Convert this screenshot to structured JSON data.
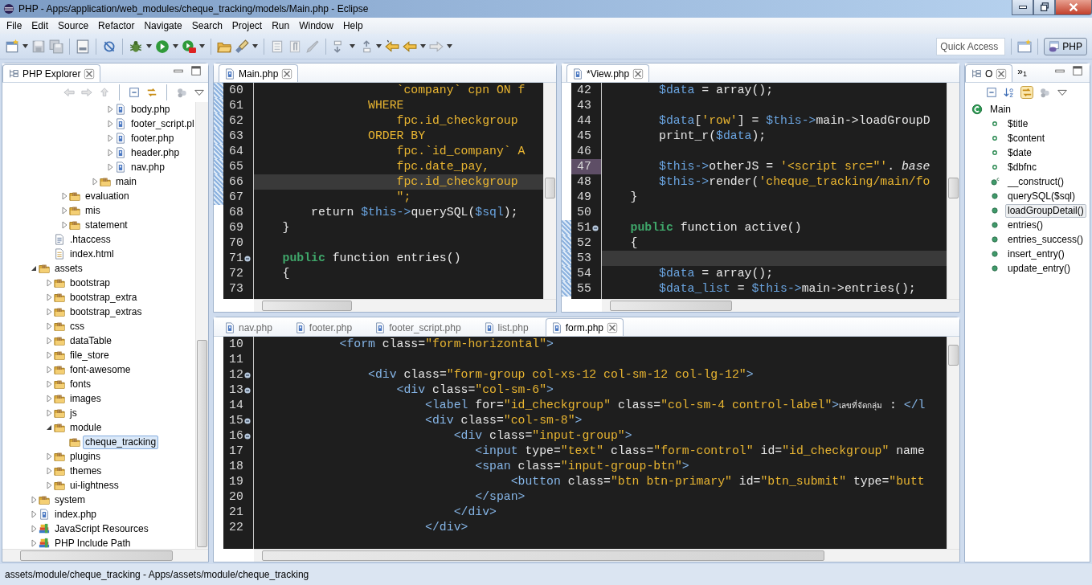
{
  "window": {
    "title": "PHP - Apps/application/web_modules/cheque_tracking/models/Main.php - Eclipse"
  },
  "menu": [
    "File",
    "Edit",
    "Source",
    "Refactor",
    "Navigate",
    "Search",
    "Project",
    "Run",
    "Window",
    "Help"
  ],
  "toolbar": {
    "quick_access": {
      "placeholder": "Quick Access"
    },
    "perspective": {
      "label": "PHP",
      "selected": true
    }
  },
  "explorer": {
    "title": "PHP Explorer",
    "tree": [
      {
        "children": [
          {
            "children": [
              {
                "children": [
                  {
                    "children": [
                      {
                        "children": [
                          {
                            "children": [
                              {
                                "label": "body.php",
                                "kind": "php",
                                "expanded": false,
                                "selected": false
                              },
                              {
                                "label": "footer_script.pl",
                                "kind": "php",
                                "expanded": false,
                                "selected": false
                              },
                              {
                                "label": "footer.php",
                                "kind": "php",
                                "expanded": false,
                                "selected": false
                              },
                              {
                                "label": "header.php",
                                "kind": "php",
                                "expanded": false,
                                "selected": false
                              },
                              {
                                "label": "nav.php",
                                "kind": "php",
                                "expanded": false,
                                "selected": false
                              }
                            ]
                          },
                          {
                            "label": "main",
                            "kind": "folder",
                            "expanded": false,
                            "selected": false
                          }
                        ]
                      }
                    ]
                  },
                  {
                    "label": "evaluation",
                    "kind": "folder",
                    "expanded": false,
                    "selected": false
                  },
                  {
                    "label": "mis",
                    "kind": "folder",
                    "expanded": false,
                    "selected": false
                  },
                  {
                    "label": "statement",
                    "kind": "folder",
                    "expanded": false,
                    "selected": false
                  }
                ]
              },
              {
                "label": ".htaccess",
                "kind": "text",
                "selected": false
              },
              {
                "label": "index.html",
                "kind": "html",
                "selected": false
              }
            ]
          },
          {
            "label": "assets",
            "kind": "folder",
            "expanded": true,
            "selected": false,
            "children": [
              {
                "label": "bootstrap",
                "kind": "folder",
                "expanded": false,
                "selected": false
              },
              {
                "label": "bootstrap_extra",
                "kind": "folder",
                "expanded": false,
                "selected": false
              },
              {
                "label": "bootstrap_extras",
                "kind": "folder",
                "expanded": false,
                "selected": false
              },
              {
                "label": "css",
                "kind": "folder",
                "expanded": false,
                "selected": false
              },
              {
                "label": "dataTable",
                "kind": "folder",
                "expanded": false,
                "selected": false
              },
              {
                "label": "file_store",
                "kind": "folder",
                "expanded": false,
                "selected": false
              },
              {
                "label": "font-awesome",
                "kind": "folder",
                "expanded": false,
                "selected": false
              },
              {
                "label": "fonts",
                "kind": "folder",
                "expanded": false,
                "selected": false
              },
              {
                "label": "images",
                "kind": "folder",
                "expanded": false,
                "selected": false
              },
              {
                "label": "js",
                "kind": "folder",
                "expanded": false,
                "selected": false
              },
              {
                "label": "module",
                "kind": "folder",
                "expanded": true,
                "selected": false,
                "children": [
                  {
                    "label": "cheque_tracking",
                    "kind": "folder",
                    "selected": true
                  }
                ]
              },
              {
                "label": "plugins",
                "kind": "folder",
                "expanded": false,
                "selected": false
              },
              {
                "label": "themes",
                "kind": "folder",
                "expanded": false,
                "selected": false
              },
              {
                "label": "ui-lightness",
                "kind": "folder",
                "expanded": false,
                "selected": false
              }
            ]
          },
          {
            "label": "system",
            "kind": "folder",
            "expanded": false,
            "selected": false
          },
          {
            "label": "index.php",
            "kind": "php",
            "expanded": false,
            "selected": false
          },
          {
            "label": "JavaScript Resources",
            "kind": "library",
            "expanded": false,
            "selected": false
          },
          {
            "label": "PHP Include Path",
            "kind": "library",
            "expanded": false,
            "selected": false
          }
        ]
      }
    ]
  },
  "editors": [
    {
      "tabs": [
        {
          "label": "Main.php",
          "selected": true
        }
      ],
      "lines": [
        {
          "number": "60",
          "changed": true,
          "current": false,
          "fold": false,
          "tokens": [
            {
              "kind": "string",
              "text": "                    `company` cpn ON f"
            }
          ]
        },
        {
          "number": "61",
          "changed": true,
          "current": false,
          "fold": false,
          "tokens": [
            {
              "kind": "string",
              "text": "                WHERE"
            }
          ]
        },
        {
          "number": "62",
          "changed": true,
          "current": false,
          "fold": false,
          "tokens": [
            {
              "kind": "string",
              "text": "                    fpc.id_checkgroup"
            }
          ]
        },
        {
          "number": "63",
          "changed": true,
          "current": false,
          "fold": false,
          "tokens": [
            {
              "kind": "string",
              "text": "                ORDER BY"
            }
          ]
        },
        {
          "number": "64",
          "changed": true,
          "current": false,
          "fold": false,
          "tokens": [
            {
              "kind": "string",
              "text": "                    fpc.`id_company` A"
            }
          ]
        },
        {
          "number": "65",
          "changed": true,
          "current": false,
          "fold": false,
          "tokens": [
            {
              "kind": "string",
              "text": "                    fpc.date_pay,"
            }
          ]
        },
        {
          "number": "66",
          "changed": true,
          "current": true,
          "fold": false,
          "tokens": [
            {
              "kind": "string",
              "text": "                    fpc.id_checkgroup"
            }
          ]
        },
        {
          "number": "67",
          "changed": true,
          "current": false,
          "fold": false,
          "tokens": [
            {
              "kind": "string",
              "text": "                    \";"
            }
          ]
        },
        {
          "number": "68",
          "changed": false,
          "current": false,
          "fold": false,
          "tokens": [
            {
              "kind": "plain",
              "text": "        return "
            },
            {
              "kind": "variable",
              "text": "$this->"
            },
            {
              "kind": "plain",
              "text": "querySQL("
            },
            {
              "kind": "variable",
              "text": "$sql"
            },
            {
              "kind": "plain",
              "text": ");"
            }
          ]
        },
        {
          "number": "69",
          "changed": false,
          "current": false,
          "fold": false,
          "tokens": [
            {
              "kind": "plain",
              "text": "    }"
            }
          ]
        },
        {
          "number": "70",
          "changed": false,
          "current": false,
          "fold": false
        },
        {
          "number": "71",
          "changed": false,
          "current": false,
          "fold": true,
          "tokens": [
            {
              "kind": "keyword",
              "text": "    public"
            },
            {
              "kind": "plain",
              "text": " function entries()"
            }
          ]
        },
        {
          "number": "72",
          "changed": false,
          "current": false,
          "fold": false,
          "tokens": [
            {
              "kind": "plain",
              "text": "    {"
            }
          ]
        },
        {
          "number": "73",
          "changed": false,
          "current": false,
          "fold": false
        }
      ]
    },
    {
      "tabs": [
        {
          "label": "*View.php",
          "selected": true
        }
      ],
      "lines": [
        {
          "number": "42",
          "changed": false,
          "current": false,
          "fold": false,
          "marked": false,
          "tokens": [
            {
              "kind": "variable",
              "text": "        $data"
            },
            {
              "kind": "plain",
              "text": " = array();"
            }
          ]
        },
        {
          "number": "43",
          "changed": false,
          "current": false,
          "fold": false,
          "marked": false
        },
        {
          "number": "44",
          "changed": false,
          "current": false,
          "fold": false,
          "marked": false,
          "tokens": [
            {
              "kind": "variable",
              "text": "        $data"
            },
            {
              "kind": "plain",
              "text": "["
            },
            {
              "kind": "string",
              "text": "'row'"
            },
            {
              "kind": "plain",
              "text": "] = "
            },
            {
              "kind": "variable",
              "text": "$this->"
            },
            {
              "kind": "plain",
              "text": "main->loadGroupD"
            }
          ]
        },
        {
          "number": "45",
          "changed": false,
          "current": false,
          "fold": false,
          "marked": false,
          "tokens": [
            {
              "kind": "plain",
              "text": "        print_r("
            },
            {
              "kind": "variable",
              "text": "$data"
            },
            {
              "kind": "plain",
              "text": ");"
            }
          ]
        },
        {
          "number": "46",
          "changed": false,
          "current": false,
          "fold": false,
          "marked": false
        },
        {
          "number": "47",
          "changed": false,
          "current": false,
          "fold": false,
          "marked": true,
          "tokens": [
            {
              "kind": "variable",
              "text": "        $this->"
            },
            {
              "kind": "plain",
              "text": "otherJS = "
            },
            {
              "kind": "string",
              "text": "'<script src=\"'"
            },
            {
              "kind": "plain",
              "text": ". "
            },
            {
              "kind": "italic",
              "text": "base"
            }
          ]
        },
        {
          "number": "48",
          "changed": false,
          "current": false,
          "fold": false,
          "marked": false,
          "tokens": [
            {
              "kind": "variable",
              "text": "        $this->"
            },
            {
              "kind": "plain",
              "text": "render("
            },
            {
              "kind": "string",
              "text": "'cheque_tracking/main/fo"
            }
          ]
        },
        {
          "number": "49",
          "changed": false,
          "current": false,
          "fold": false,
          "marked": false,
          "tokens": [
            {
              "kind": "plain",
              "text": "    }"
            }
          ]
        },
        {
          "number": "50",
          "changed": false,
          "current": false,
          "fold": false,
          "marked": false
        },
        {
          "number": "51",
          "changed": true,
          "current": false,
          "fold": true,
          "marked": false,
          "tokens": [
            {
              "kind": "keyword",
              "text": "    public"
            },
            {
              "kind": "plain",
              "text": " function active()"
            }
          ]
        },
        {
          "number": "52",
          "changed": true,
          "current": false,
          "fold": false,
          "marked": false,
          "tokens": [
            {
              "kind": "plain",
              "text": "    {"
            }
          ]
        },
        {
          "number": "53",
          "changed": true,
          "current": true,
          "fold": false,
          "marked": false
        },
        {
          "number": "54",
          "changed": true,
          "current": false,
          "fold": false,
          "marked": false,
          "tokens": [
            {
              "kind": "variable",
              "text": "        $data"
            },
            {
              "kind": "plain",
              "text": " = array();"
            }
          ]
        },
        {
          "number": "55",
          "changed": true,
          "current": false,
          "fold": false,
          "marked": false,
          "tokens": [
            {
              "kind": "variable",
              "text": "        $data_list"
            },
            {
              "kind": "plain",
              "text": " = "
            },
            {
              "kind": "variable",
              "text": "$this->"
            },
            {
              "kind": "plain",
              "text": "main->entries();"
            }
          ]
        }
      ]
    },
    {
      "tabs": [
        {
          "label": "nav.php",
          "selected": false
        },
        {
          "label": "footer.php",
          "selected": false
        },
        {
          "label": "footer_script.php",
          "selected": false
        },
        {
          "label": "list.php",
          "selected": false
        },
        {
          "label": "form.php",
          "selected": true
        }
      ],
      "lines": [
        {
          "number": "10",
          "changed": false,
          "current": false,
          "fold": false,
          "tokens": [
            {
              "kind": "tag",
              "text": "            <form "
            },
            {
              "kind": "plain",
              "text": "class="
            },
            {
              "kind": "string",
              "text": "\"form-horizontal\""
            },
            {
              "kind": "tag",
              "text": ">"
            }
          ]
        },
        {
          "number": "11",
          "changed": false,
          "current": false,
          "fold": false
        },
        {
          "number": "12",
          "changed": false,
          "current": false,
          "fold": true,
          "tokens": [
            {
              "kind": "tag",
              "text": "                <div "
            },
            {
              "kind": "plain",
              "text": "class="
            },
            {
              "kind": "string",
              "text": "\"form-group col-xs-12 col-sm-12 col-lg-12\""
            },
            {
              "kind": "tag",
              "text": ">"
            }
          ]
        },
        {
          "number": "13",
          "changed": false,
          "current": false,
          "fold": true,
          "tokens": [
            {
              "kind": "tag",
              "text": "                    <div "
            },
            {
              "kind": "plain",
              "text": "class="
            },
            {
              "kind": "string",
              "text": "\"col-sm-6\""
            },
            {
              "kind": "tag",
              "text": ">"
            }
          ]
        },
        {
          "number": "14",
          "changed": false,
          "current": false,
          "fold": false,
          "tokens": [
            {
              "kind": "tag",
              "text": "                        <label "
            },
            {
              "kind": "plain",
              "text": "for="
            },
            {
              "kind": "string",
              "text": "\"id_checkgroup\""
            },
            {
              "kind": "plain",
              "text": " class="
            },
            {
              "kind": "string",
              "text": "\"col-sm-4 control-label\""
            },
            {
              "kind": "tag",
              "text": ">"
            },
            {
              "kind": "small",
              "text": "เลขที่จัดกลุ่ม"
            },
            {
              "kind": "plain",
              "text": " : "
            },
            {
              "kind": "tag",
              "text": "</l"
            }
          ]
        },
        {
          "number": "15",
          "changed": false,
          "current": false,
          "fold": true,
          "tokens": [
            {
              "kind": "tag",
              "text": "                        <div "
            },
            {
              "kind": "plain",
              "text": "class="
            },
            {
              "kind": "string",
              "text": "\"col-sm-8\""
            },
            {
              "kind": "tag",
              "text": ">"
            }
          ]
        },
        {
          "number": "16",
          "changed": false,
          "current": false,
          "fold": true,
          "tokens": [
            {
              "kind": "tag",
              "text": "                            <div "
            },
            {
              "kind": "plain",
              "text": "class="
            },
            {
              "kind": "string",
              "text": "\"input-group\""
            },
            {
              "kind": "tag",
              "text": ">"
            }
          ]
        },
        {
          "number": "17",
          "changed": false,
          "current": false,
          "fold": false,
          "tokens": [
            {
              "kind": "tag",
              "text": "                               <input "
            },
            {
              "kind": "plain",
              "text": "type="
            },
            {
              "kind": "string",
              "text": "\"text\""
            },
            {
              "kind": "plain",
              "text": " class="
            },
            {
              "kind": "string",
              "text": "\"form-control\""
            },
            {
              "kind": "plain",
              "text": " id="
            },
            {
              "kind": "string",
              "text": "\"id_checkgroup\""
            },
            {
              "kind": "plain",
              "text": " name"
            }
          ]
        },
        {
          "number": "18",
          "changed": false,
          "current": false,
          "fold": false,
          "tokens": [
            {
              "kind": "tag",
              "text": "                               <span "
            },
            {
              "kind": "plain",
              "text": "class="
            },
            {
              "kind": "string",
              "text": "\"input-group-btn\""
            },
            {
              "kind": "tag",
              "text": ">"
            }
          ]
        },
        {
          "number": "19",
          "changed": false,
          "current": false,
          "fold": false,
          "tokens": [
            {
              "kind": "tag",
              "text": "                                    <button "
            },
            {
              "kind": "plain",
              "text": "class="
            },
            {
              "kind": "string",
              "text": "\"btn btn-primary\""
            },
            {
              "kind": "plain",
              "text": " id="
            },
            {
              "kind": "string",
              "text": "\"btn_submit\""
            },
            {
              "kind": "plain",
              "text": " type="
            },
            {
              "kind": "string",
              "text": "\"butt"
            }
          ]
        },
        {
          "number": "20",
          "changed": false,
          "current": false,
          "fold": false,
          "tokens": [
            {
              "kind": "tag",
              "text": "                               </span>"
            }
          ]
        },
        {
          "number": "21",
          "changed": false,
          "current": false,
          "fold": false,
          "tokens": [
            {
              "kind": "tag",
              "text": "                            </div>"
            }
          ]
        },
        {
          "number": "22",
          "changed": false,
          "current": false,
          "fold": false,
          "tokens": [
            {
              "kind": "tag",
              "text": "                        </div>"
            }
          ]
        }
      ]
    }
  ],
  "outline": {
    "title": "O",
    "overflow": "»$_{1}$",
    "items": [
      {
        "label": "Main",
        "kind": "class",
        "children": [
          {
            "label": "$title",
            "kind": "field",
            "selected": false
          },
          {
            "label": "$content",
            "kind": "field",
            "selected": false
          },
          {
            "label": "$date",
            "kind": "field",
            "selected": false
          },
          {
            "label": "$dbfnc",
            "kind": "field",
            "selected": false
          },
          {
            "label": "__construct()",
            "kind": "constructor",
            "selected": false
          },
          {
            "label": "querySQL($sql)",
            "kind": "method",
            "selected": false
          },
          {
            "label": "loadGroupDetail()",
            "kind": "method",
            "selected": true
          },
          {
            "label": "entries()",
            "kind": "method",
            "selected": false
          },
          {
            "label": "entries_success()",
            "kind": "method",
            "selected": false
          },
          {
            "label": "insert_entry()",
            "kind": "method",
            "selected": false
          },
          {
            "label": "update_entry()",
            "kind": "method",
            "selected": false
          }
        ]
      }
    ]
  },
  "status_bar": "assets/module/cheque_tracking - Apps/assets/module/cheque_tracking"
}
